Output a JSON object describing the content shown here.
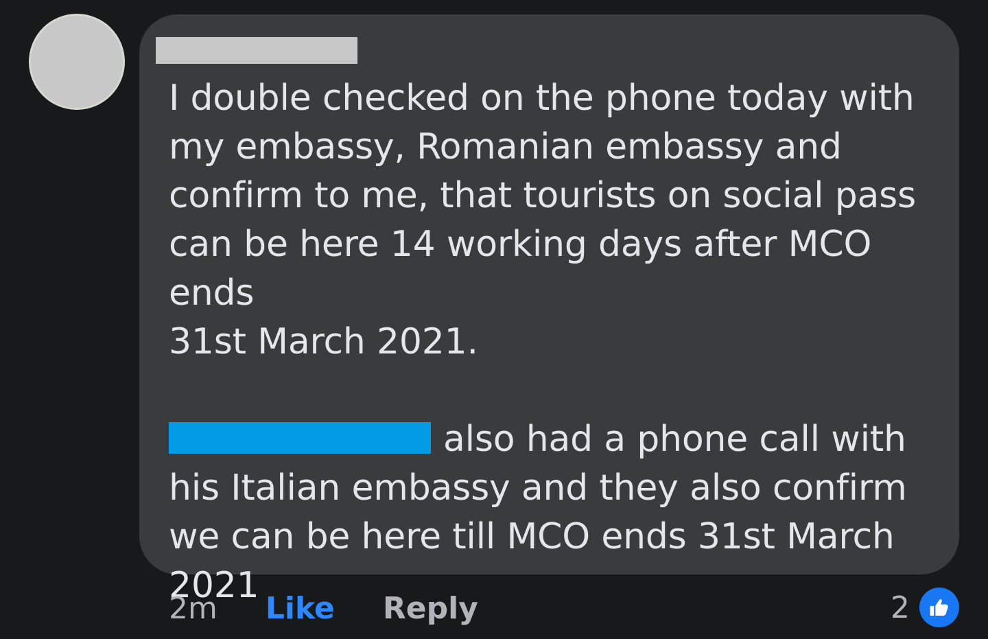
{
  "comment": {
    "text": "I double checked on the phone today with\nmy embassy, Romanian embassy and\nconfirm to me, that tourists on social pass\ncan be here 14 working days after MCO ends\n31st March 2021.",
    "mention_text": "also had a phone call with\nhis Italian embassy and they also confirm\nwe can be here till MCO ends 31st March\n2021"
  },
  "actions": {
    "time": "2m",
    "like_label": "Like",
    "reply_label": "Reply",
    "reaction_count": "2",
    "reaction_icon": "thumbs-up-icon"
  },
  "colors": {
    "background": "#18191b",
    "bubble": "#3a3b3c",
    "text": "#e4e6eb",
    "secondary_text": "#b0b3b8",
    "like_blue": "#2d88ff",
    "mention_blue": "#039be5",
    "reaction_blue": "#1877f2"
  }
}
